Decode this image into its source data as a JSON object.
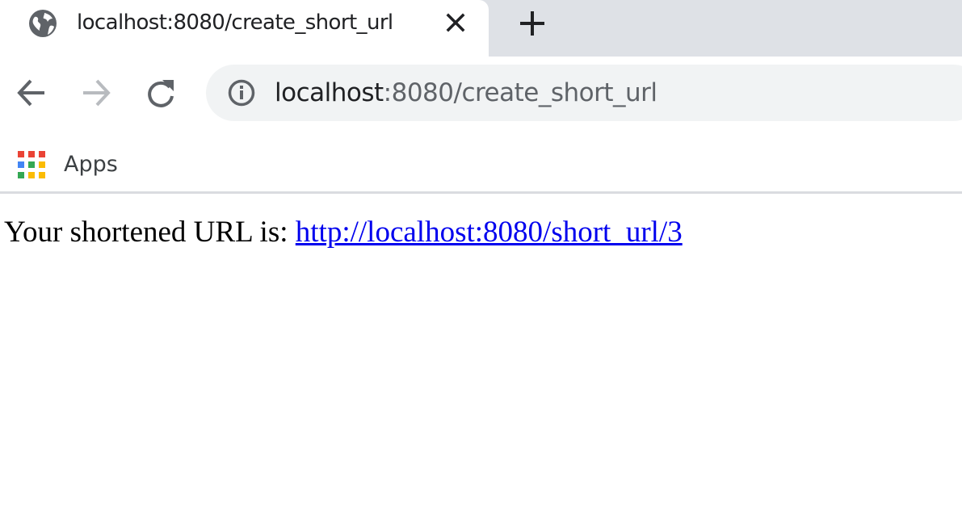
{
  "tab": {
    "title": "localhost:8080/create_short_url"
  },
  "toolbar": {
    "url_host": "localhost",
    "url_rest": ":8080/create_short_url"
  },
  "bookmarks": {
    "apps_label": "Apps"
  },
  "page": {
    "message": "Your shortened URL is: ",
    "link_text": "http://localhost:8080/short_url/3",
    "link_href": "http://localhost:8080/short_url/3"
  },
  "icons": {
    "favicon": "globe-icon",
    "tab_close": "close-icon",
    "new_tab": "plus-icon",
    "back": "arrow-left-icon",
    "forward": "arrow-right-icon",
    "reload": "reload-icon",
    "site_info": "info-icon",
    "apps": "apps-grid-icon"
  },
  "colors": {
    "tab_strip": "#dee1e6",
    "omnibox": "#f1f3f4",
    "link": "#0000ee",
    "apps_red": "#ea4335",
    "apps_green": "#34a853",
    "apps_blue": "#4285f4",
    "apps_yellow": "#fbbc04"
  }
}
